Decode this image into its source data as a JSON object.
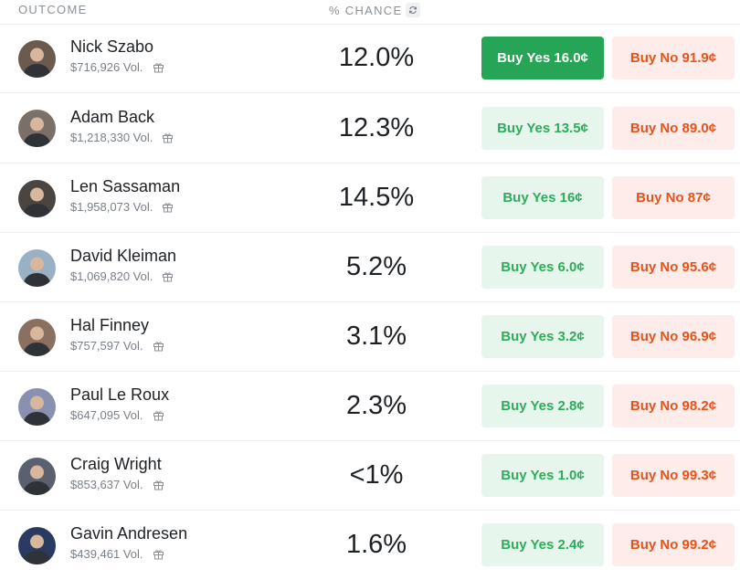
{
  "header": {
    "outcome_label": "OUTCOME",
    "chance_label": "% CHANCE",
    "refresh_icon": "refresh-icon"
  },
  "colors": {
    "yes_active_bg": "#27a556",
    "yes_bg": "#e7f6ec",
    "yes_text": "#2eac5b",
    "no_bg": "#fdecea",
    "no_text": "#e4541a"
  },
  "outcomes": [
    {
      "name": "Nick Szabo",
      "volume": "$716,926 Vol.",
      "chance": "12.0%",
      "buy_yes": "Buy Yes 16.0¢",
      "buy_no": "Buy No 91.9¢",
      "yes_selected": true
    },
    {
      "name": "Adam Back",
      "volume": "$1,218,330 Vol.",
      "chance": "12.3%",
      "buy_yes": "Buy Yes 13.5¢",
      "buy_no": "Buy No 89.0¢",
      "yes_selected": false
    },
    {
      "name": "Len Sassaman",
      "volume": "$1,958,073 Vol.",
      "chance": "14.5%",
      "buy_yes": "Buy Yes 16¢",
      "buy_no": "Buy No 87¢",
      "yes_selected": false
    },
    {
      "name": "David Kleiman",
      "volume": "$1,069,820 Vol.",
      "chance": "5.2%",
      "buy_yes": "Buy Yes 6.0¢",
      "buy_no": "Buy No 95.6¢",
      "yes_selected": false
    },
    {
      "name": "Hal Finney",
      "volume": "$757,597 Vol.",
      "chance": "3.1%",
      "buy_yes": "Buy Yes 3.2¢",
      "buy_no": "Buy No 96.9¢",
      "yes_selected": false
    },
    {
      "name": "Paul Le Roux",
      "volume": "$647,095 Vol.",
      "chance": "2.3%",
      "buy_yes": "Buy Yes 2.8¢",
      "buy_no": "Buy No 98.2¢",
      "yes_selected": false
    },
    {
      "name": "Craig Wright",
      "volume": "$853,637 Vol.",
      "chance": "<1%",
      "buy_yes": "Buy Yes 1.0¢",
      "buy_no": "Buy No 99.3¢",
      "yes_selected": false
    },
    {
      "name": "Gavin Andresen",
      "volume": "$439,461 Vol.",
      "chance": "1.6%",
      "buy_yes": "Buy Yes 2.4¢",
      "buy_no": "Buy No 99.2¢",
      "yes_selected": false
    }
  ]
}
